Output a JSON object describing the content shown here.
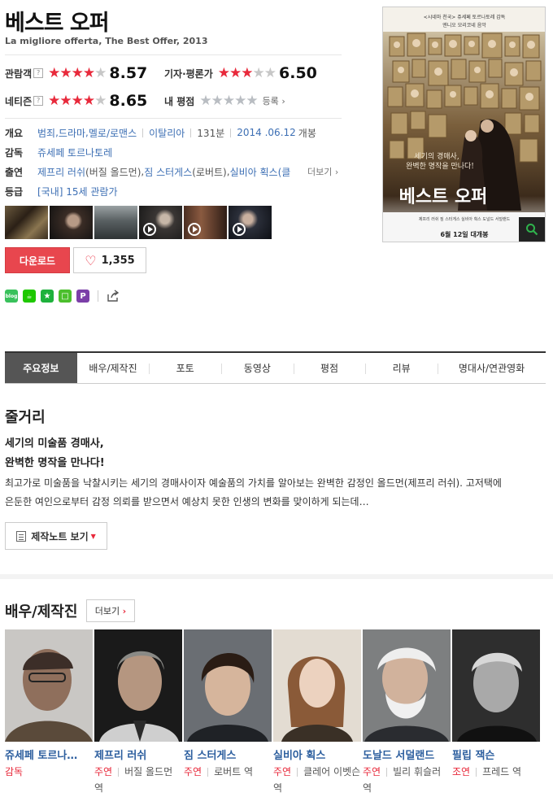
{
  "movie": {
    "title": "베스트 오퍼",
    "original_title": "La migliore offerta, The Best Offer, 2013"
  },
  "ratings": {
    "audience": {
      "label": "관람객",
      "help": "?",
      "stars": 4.3,
      "score": "8.57"
    },
    "critics": {
      "label": "기자·평론가",
      "stars": 3.25,
      "score": "6.50"
    },
    "netizen": {
      "label": "네티즌",
      "help": "?",
      "stars": 4.3,
      "score": "8.65"
    },
    "my_rating": {
      "label": "내 평점",
      "stars": 0,
      "register": "등록",
      "register_arrow": "›"
    }
  },
  "info": {
    "overview": {
      "label": "개요",
      "genres": [
        "범죄",
        "드라마",
        "멜로/로맨스"
      ],
      "country": "이탈리아",
      "runtime": "131분",
      "release_date": "2014 .06.12",
      "release_suffix": "개봉"
    },
    "director": {
      "label": "감독",
      "name": "쥬세페 토르나토레"
    },
    "cast": {
      "label": "출연",
      "actors": [
        "제프리 러쉬",
        "짐 스터게스",
        "실비아 획스(클"
      ],
      "roles": [
        "(버질 올드먼)",
        "(로버트)"
      ],
      "more": "더보기",
      "more_arrow": "›"
    },
    "rating_grade": {
      "label": "등급",
      "value": "[국내] 15세 관람가"
    }
  },
  "thumbnails": [
    {
      "type": "photo"
    },
    {
      "type": "photo"
    },
    {
      "type": "photo"
    },
    {
      "type": "video"
    },
    {
      "type": "video"
    },
    {
      "type": "video"
    }
  ],
  "actions": {
    "download": "다운로드",
    "like_count": "1,355",
    "heart_icon": "♡"
  },
  "share_icons": [
    {
      "name": "blog-share-icon",
      "text": "blog",
      "color": "#39c15b"
    },
    {
      "name": "cafe-share-icon",
      "text": "☕",
      "color": "#1ec800"
    },
    {
      "name": "me2-share-icon",
      "text": "★",
      "color": "#1eb13c"
    },
    {
      "name": "band-share-icon",
      "text": "□",
      "color": "#4bbf2c"
    },
    {
      "name": "post-share-icon",
      "text": "P",
      "color": "#7b3fa8"
    }
  ],
  "poster": {
    "tagline": "<시네마 천국> 쥬세페 토르나토레 감독",
    "subtitle": "엔니오 모리코네 음악",
    "copy_line1": "세기의 경매사,",
    "copy_line2": "완벽한 명작을 만나다!",
    "title": "베스트 오퍼",
    "credits": "제프리 러쉬  짐 스터게스  실비아 획스  도널드 서덜랜드",
    "release": "6월 12일 대개봉"
  },
  "tabs": [
    "주요정보",
    "배우/제작진",
    "포토",
    "동영상",
    "평점",
    "리뷰",
    "명대사/연관영화"
  ],
  "synopsis": {
    "heading": "줄거리",
    "headline1": "세기의 미술품 경매사,",
    "headline2": "완벽한 명작을 만나다!",
    "body_line1": "최고가로 미술품을 낙찰시키는 세기의 경매사이자 예술품의 가치를 알아보는 완벽한 감정인 올드먼(제프리 러쉬). 고저택에",
    "body_line2": "은둔한 여인으로부터 감정 의뢰를 받으면서 예상치 못한 인생의 변화를 맞이하게 되는데…",
    "note_button": "제작노트 보기",
    "note_caret": "▼"
  },
  "cast_section": {
    "heading": "배우/제작진",
    "more": "더보기",
    "more_arrow": "›",
    "people": [
      {
        "name": "쥬세페 토르나…",
        "role": "감독",
        "character": ""
      },
      {
        "name": "제프리 러쉬",
        "role": "주연",
        "character": "버질 올드먼 역"
      },
      {
        "name": "짐 스터게스",
        "role": "주연",
        "character": "로버트 역"
      },
      {
        "name": "실비아 획스",
        "role": "주연",
        "character": "클레어 이벳슨 역"
      },
      {
        "name": "도날드 서덜랜드",
        "role": "주연",
        "character": "빌리 휘슬러 역"
      },
      {
        "name": "필립 잭슨",
        "role": "조연",
        "character": "프레드 역"
      }
    ]
  }
}
